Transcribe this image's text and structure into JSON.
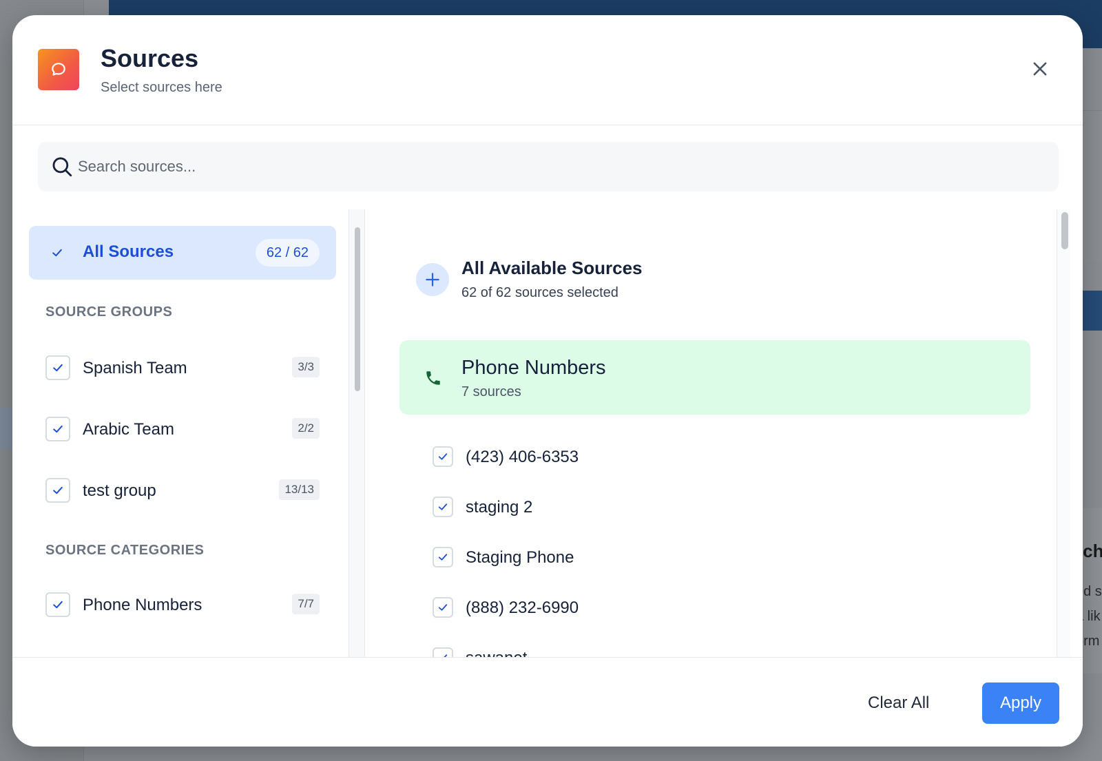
{
  "modal": {
    "title": "Sources",
    "subtitle": "Select sources here"
  },
  "search": {
    "placeholder": "Search sources..."
  },
  "all_sources": {
    "label": "All Sources",
    "count": "62 / 62"
  },
  "source_groups": {
    "heading": "SOURCE GROUPS",
    "items": [
      {
        "label": "Spanish Team",
        "count": "3/3"
      },
      {
        "label": "Arabic Team",
        "count": "2/2"
      },
      {
        "label": "test group",
        "count": "13/13"
      }
    ]
  },
  "source_categories": {
    "heading": "SOURCE CATEGORIES",
    "items": [
      {
        "label": "Phone Numbers",
        "count": "7/7"
      }
    ]
  },
  "available": {
    "title": "All Available Sources",
    "subtitle": "62 of 62 sources selected"
  },
  "category_card": {
    "title": "Phone Numbers",
    "subtitle": "7 sources",
    "sources": [
      "(423) 406-6353",
      "staging 2",
      "Staging Phone",
      "(888) 232-6990",
      "sawanet"
    ]
  },
  "footer": {
    "clear_label": "Clear All",
    "apply_label": "Apply"
  },
  "background": {
    "right_text": "rch",
    "right_lines": [
      "ed s",
      "a lik",
      "orm"
    ]
  },
  "colors": {
    "accent": "#3b82f6",
    "selected_bg": "#dbe8fd",
    "category_bg": "#dcfce7",
    "check": "#1d4ed8"
  }
}
